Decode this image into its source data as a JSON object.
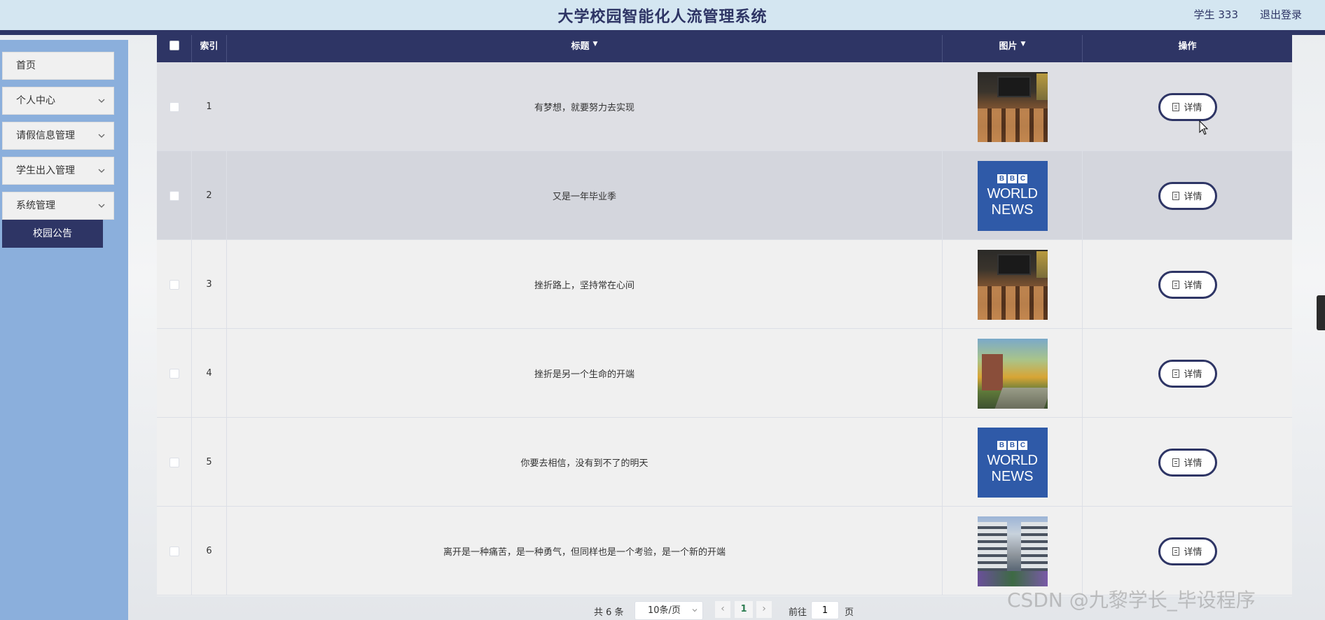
{
  "header": {
    "title": "大学校园智能化人流管理系统",
    "user": "学生 333",
    "logout": "退出登录"
  },
  "sidebar": {
    "items": [
      {
        "label": "首页"
      },
      {
        "label": "个人中心"
      },
      {
        "label": "请假信息管理"
      },
      {
        "label": "学生出入管理"
      },
      {
        "label": "系统管理"
      }
    ],
    "active_sub": "校园公告"
  },
  "table": {
    "columns": {
      "index": "索引",
      "title": "标题",
      "image": "图片",
      "action": "操作"
    },
    "rows": [
      {
        "index": "1",
        "title": "有梦想，就要努力去实现",
        "image": "classroom",
        "action": "详情"
      },
      {
        "index": "2",
        "title": "又是一年毕业季",
        "image": "bbc-world-news",
        "action": "详情"
      },
      {
        "index": "3",
        "title": "挫折路上，坚持常在心间",
        "image": "classroom",
        "action": "详情"
      },
      {
        "index": "4",
        "title": "挫折是另一个生命的开端",
        "image": "campus-sunset",
        "action": "详情"
      },
      {
        "index": "5",
        "title": "你要去相信，没有到不了的明天",
        "image": "bbc-world-news",
        "action": "详情"
      },
      {
        "index": "6",
        "title": "离开是一种痛苦，是一种勇气，但同样也是一个考验，是一个新的开端",
        "image": "modern-building",
        "action": "详情"
      }
    ],
    "bbc_logo": {
      "b1": "B",
      "b2": "B",
      "c": "C",
      "line1": "WORLD",
      "line2": "NEWS"
    }
  },
  "pagination": {
    "total": "共 6 条",
    "page_size": "10条/页",
    "current_page": "1",
    "goto_label": "前往",
    "goto_value": "1",
    "page_suffix": "页",
    "prev_icon": "chevron-left-icon",
    "next_icon": "chevron-right-icon"
  },
  "watermark": "CSDN @九黎学长_毕设程序",
  "colors": {
    "primary": "#2e3565",
    "header_bg": "#d4e6f1",
    "sidebar_bg": "#8bafdc",
    "row_bg": "#f0f0f0",
    "row_hover": "#dedfe4",
    "row_alt": "#d4d6dd"
  }
}
